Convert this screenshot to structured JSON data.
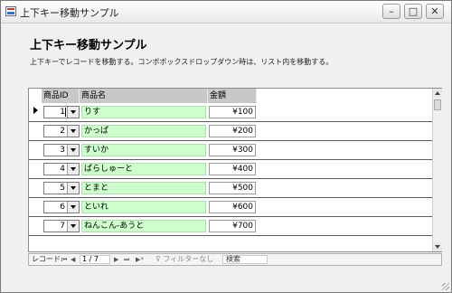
{
  "window": {
    "title": "上下キー移動サンプル",
    "min_glyph": "–",
    "max_glyph": "□",
    "close_glyph": "✕"
  },
  "form": {
    "header": "上下キー移動サンプル",
    "description": "上下キーでレコードを移動する。コンボボックスドロップダウン時は、リスト内を移動する。"
  },
  "grid": {
    "columns": [
      "商品ID",
      "商品名",
      "金額"
    ],
    "rows": [
      {
        "id": "1",
        "name": "りす",
        "price": "¥100"
      },
      {
        "id": "2",
        "name": "かっぱ",
        "price": "¥200"
      },
      {
        "id": "3",
        "name": "すいか",
        "price": "¥300"
      },
      {
        "id": "4",
        "name": "ぱらしゅーと",
        "price": "¥400"
      },
      {
        "id": "5",
        "name": "とまと",
        "price": "¥500"
      },
      {
        "id": "6",
        "name": "といれ",
        "price": "¥600"
      },
      {
        "id": "7",
        "name": "ねんこん-あうと",
        "price": "¥700"
      }
    ],
    "current_row": 0
  },
  "navigation": {
    "label": "レコード:",
    "first": "⏮",
    "prev": "◀",
    "position": "1 / 7",
    "next": "▶",
    "last": "⏭",
    "new": "▶*",
    "filter_icon": "funnel-icon",
    "filter_label": "フィルターなし",
    "search_placeholder": "検索"
  }
}
